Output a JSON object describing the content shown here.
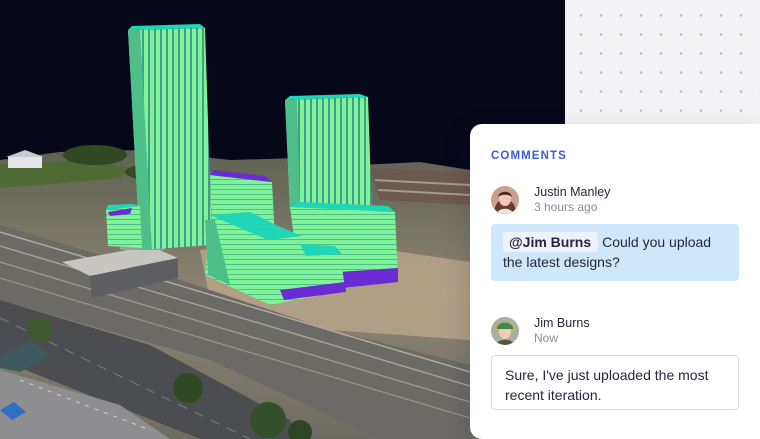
{
  "viewer": {
    "colors": {
      "sky": "#07071a",
      "building": "#7ff29a",
      "roof": "#1fd6b8",
      "accent": "#6a2bd3"
    }
  },
  "comments": {
    "title": "COMMENTS",
    "items": [
      {
        "author": "Justin Manley",
        "time": "3 hours ago",
        "mention": "@Jim Burns",
        "text": "Could you upload the latest designs?",
        "bubble_color": "#cfe7fb",
        "avatar_icon": "user-avatar-icon"
      },
      {
        "author": "Jim Burns",
        "time": "Now",
        "text": "Sure, I've just uploaded the most recent iteration.",
        "bubble_color": "#ffffff",
        "avatar_icon": "user-avatar-icon"
      }
    ]
  }
}
